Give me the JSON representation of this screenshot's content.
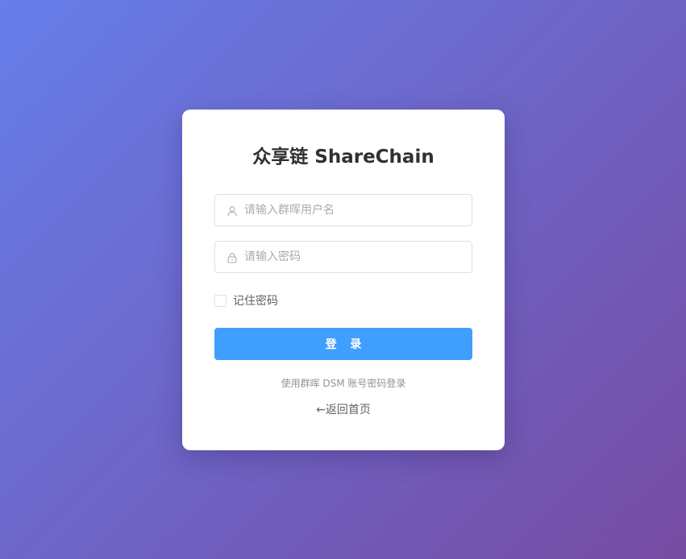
{
  "login": {
    "title": "众享链 ShareChain",
    "username": {
      "placeholder": "请输入群晖用户名",
      "value": "",
      "icon": "user-icon"
    },
    "password": {
      "placeholder": "请输入密码",
      "value": "",
      "icon": "lock-icon"
    },
    "remember": {
      "label": "记住密码",
      "checked": false
    },
    "submit_label": "登 录",
    "hint": "使用群晖 DSM 账号密码登录",
    "back": {
      "arrow": "←",
      "label": "返回首页"
    }
  },
  "colors": {
    "background_start": "#667eea",
    "background_end": "#764ba2",
    "card": "#ffffff",
    "primary": "#409eff",
    "title_text": "#303133",
    "body_text": "#606266",
    "hint_text": "#909399",
    "border": "#dcdfe6"
  }
}
